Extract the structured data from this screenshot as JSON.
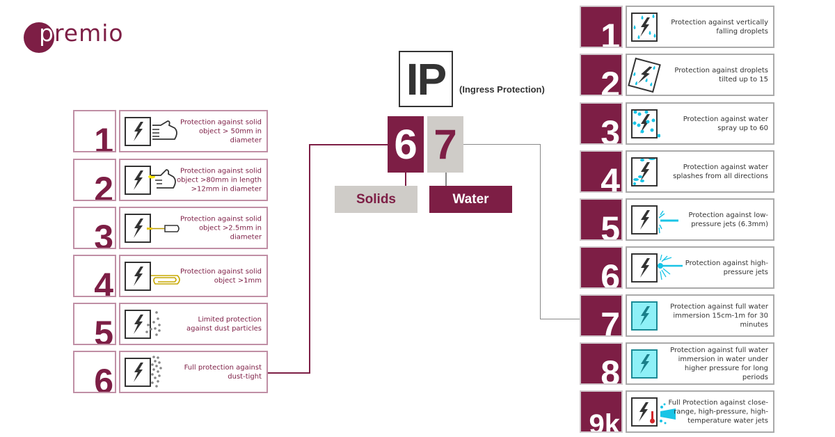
{
  "brand": {
    "logo_text": "premio",
    "colors": {
      "maroon": "#7d1e45",
      "gray": "#cfccc8",
      "dark": "#333333",
      "water_blue": "#19c4e6"
    }
  },
  "center": {
    "ip_label": "IP",
    "ip_subtitle": "(Ingress Protection)",
    "first_digit": "6",
    "second_digit": "7",
    "first_category": "Solids",
    "second_category": "Water"
  },
  "solids": [
    {
      "level": "1",
      "icon": "hand-icon",
      "description": "Protection against solid object > 50mm in diameter"
    },
    {
      "level": "2",
      "icon": "finger-icon",
      "description": "Protection against solid object >80mm in length >12mm in diameter"
    },
    {
      "level": "3",
      "icon": "screwdriver-icon",
      "description": "Protection against solid object >2.5mm in diameter"
    },
    {
      "level": "4",
      "icon": "paperclip-icon",
      "description": "Protection against solid object >1mm"
    },
    {
      "level": "5",
      "icon": "dust-icon",
      "description": "Limited protection against dust particles"
    },
    {
      "level": "6",
      "icon": "dense-dust-icon",
      "description": "Full protection against dust-tight"
    }
  ],
  "water": [
    {
      "level": "1",
      "icon": "vertical-droplets-icon",
      "description": "Protection against vertically falling droplets"
    },
    {
      "level": "2",
      "icon": "tilted-droplets-icon",
      "description": "Protection against droplets tilted up to 15"
    },
    {
      "level": "3",
      "icon": "spray-icon",
      "description": "Protection against water spray up to 60"
    },
    {
      "level": "4",
      "icon": "splash-icon",
      "description": "Protection against water splashes from all directions"
    },
    {
      "level": "5",
      "icon": "low-pressure-jet-icon",
      "description": "Protection against low-pressure jets (6.3mm)"
    },
    {
      "level": "6",
      "icon": "high-pressure-jet-icon",
      "description": "Protection against high-pressure jets"
    },
    {
      "level": "7",
      "icon": "immersion-icon",
      "description": "Protection against full water immersion 15cm-1m for 30 minutes"
    },
    {
      "level": "8",
      "icon": "deep-immersion-icon",
      "description": "Protection against full water immersion in water under higher pressure for long periods"
    },
    {
      "level": "9k",
      "icon": "hot-jet-icon",
      "description": "Full Protection against close-range, high-pressure, high-temperature water jets"
    }
  ]
}
